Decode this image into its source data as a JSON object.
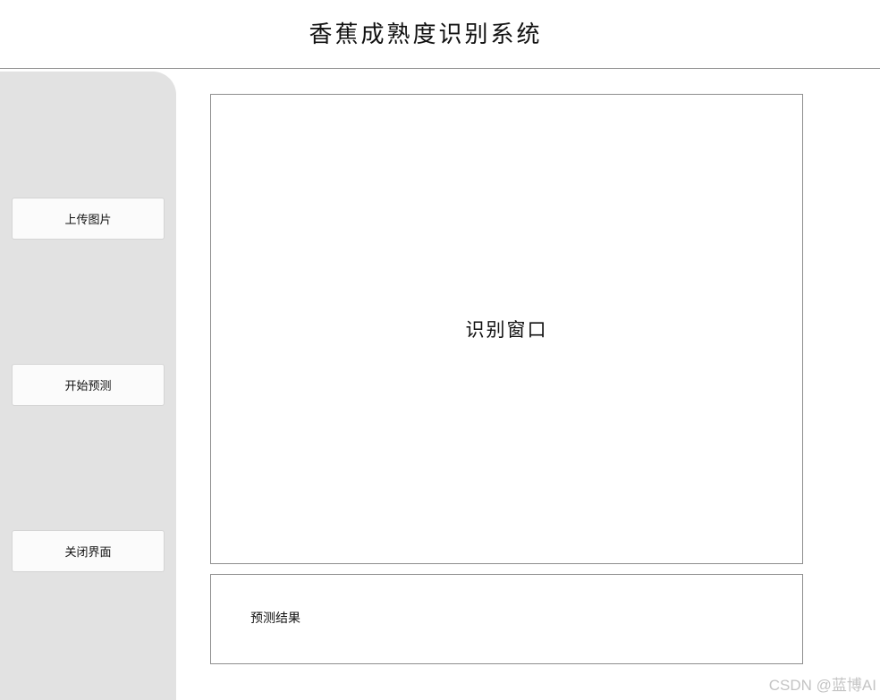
{
  "header": {
    "title": "香蕉成熟度识别系统"
  },
  "sidebar": {
    "buttons": [
      {
        "label": "上传图片"
      },
      {
        "label": "开始预测"
      },
      {
        "label": "关闭界面"
      }
    ]
  },
  "main": {
    "recognition_window_label": "识别窗口",
    "result_label": "预测结果"
  },
  "watermark": {
    "text": "CSDN @蓝博AI"
  },
  "colors": {
    "sidebar_bg": "#e2e2e2",
    "button_bg": "#fbfbfb",
    "border": "#8e8e8e",
    "watermark": "#c4c4c4"
  }
}
